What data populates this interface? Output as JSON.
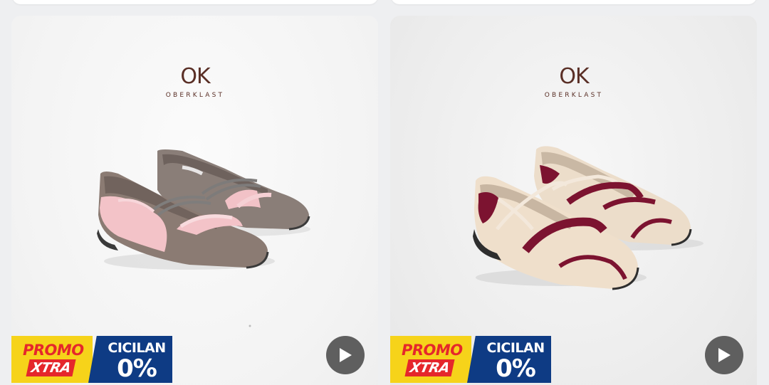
{
  "products": [
    {
      "brand_mark": "OK",
      "brand_name": "OBERKLAST",
      "image_icon": "shoe-taupe-pink-icon",
      "promo": {
        "label": "PROMO",
        "sub_label": "XTRA",
        "installment_label": "CICILAN",
        "installment_value": "0%"
      },
      "video_icon": "play-icon"
    },
    {
      "brand_mark": "OK",
      "brand_name": "OBERKLAST",
      "image_icon": "shoe-cream-maroon-icon",
      "promo": {
        "label": "PROMO",
        "sub_label": "XTRA",
        "installment_label": "CICILAN",
        "installment_value": "0%"
      },
      "video_icon": "play-icon"
    }
  ],
  "colors": {
    "promo_yellow": "#f6d31a",
    "promo_red": "#e5272b",
    "cicilan_blue": "#0e3b84",
    "brand_brown": "#5a2f26",
    "play_gray": "#5f5f5f"
  }
}
